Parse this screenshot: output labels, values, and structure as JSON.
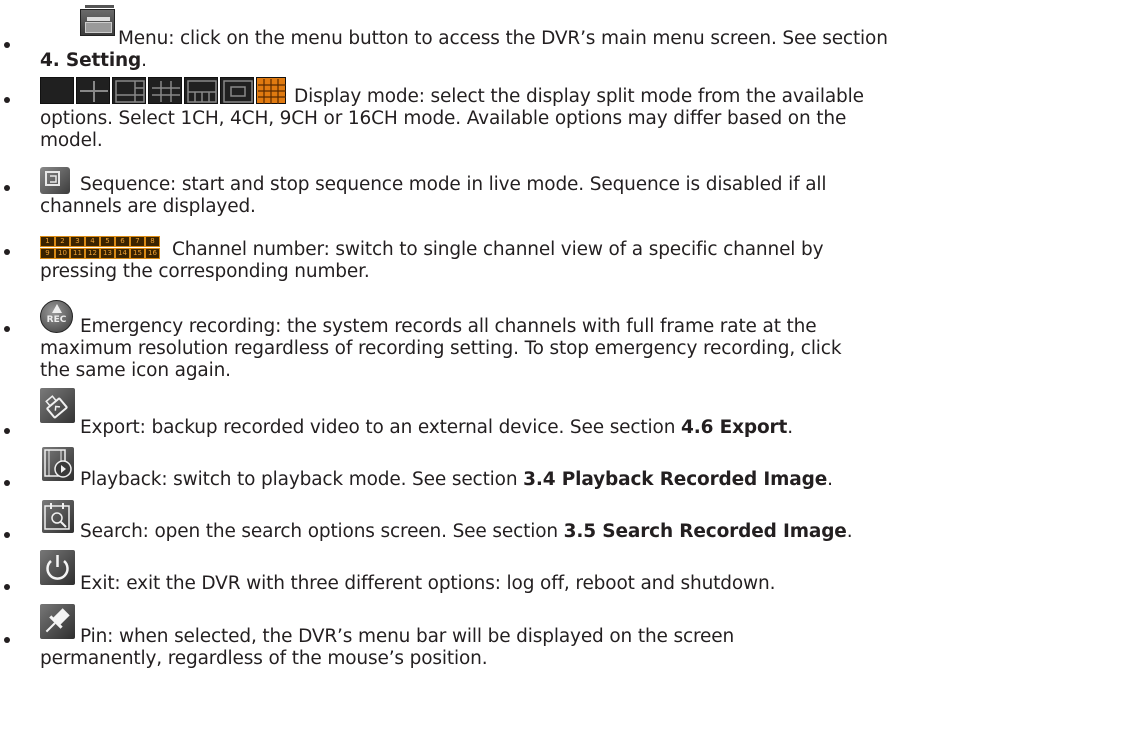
{
  "items": [
    {
      "name": "menu",
      "icon": "menu-monitor-icon",
      "lines": [
        {
          "text": "Menu: click on the menu button to access the DVR’s main menu screen. See section",
          "ref": ""
        },
        {
          "text": "",
          "ref": "4. Setting",
          "after": "."
        }
      ]
    },
    {
      "name": "display-mode",
      "icon": "display-split-icons",
      "lines": [
        {
          "text": "Display mode: select the display split mode from the available",
          "ref": ""
        },
        {
          "text": "options. Select 1CH, 4CH, 9CH or 16CH mode. Available options may differ based on the",
          "ref": ""
        },
        {
          "text": "model.",
          "ref": ""
        }
      ]
    },
    {
      "name": "sequence",
      "icon": "sequence-icon",
      "lines": [
        {
          "text": "Sequence: start and stop sequence mode in live mode. Sequence is disabled if all",
          "ref": ""
        },
        {
          "text": "channels are displayed.",
          "ref": ""
        }
      ]
    },
    {
      "name": "channel-number",
      "icon": "channel-number-icons",
      "channels": [
        "1",
        "2",
        "3",
        "4",
        "5",
        "6",
        "7",
        "8",
        "9",
        "10",
        "11",
        "12",
        "13",
        "14",
        "15",
        "16"
      ],
      "lines": [
        {
          "text": "Channel number: switch to single channel view of a specific channel by",
          "ref": ""
        },
        {
          "text": "pressing the corresponding number.",
          "ref": ""
        }
      ]
    },
    {
      "name": "emergency-recording",
      "icon": "rec-warning-icon",
      "icon_label": "REC",
      "lines": [
        {
          "text": "Emergency recording: the system records all channels with full frame rate at the",
          "ref": ""
        },
        {
          "text": "maximum resolution regardless of recording setting. To stop emergency recording, click",
          "ref": ""
        },
        {
          "text": "the same icon again.",
          "ref": ""
        }
      ]
    },
    {
      "name": "export",
      "icon": "usb-export-icon",
      "lines": [
        {
          "text": "Export: backup recorded video to an external device. See section ",
          "ref": "4.6 Export",
          "after": "."
        }
      ]
    },
    {
      "name": "playback",
      "icon": "film-play-icon",
      "lines": [
        {
          "text": "Playback: switch to playback mode. See section ",
          "ref": "3.4 Playback Recorded Image",
          "after": "."
        }
      ]
    },
    {
      "name": "search",
      "icon": "calendar-search-icon",
      "lines": [
        {
          "text": "Search: open the search options screen. See section ",
          "ref": "3.5 Search Recorded Image",
          "after": "."
        }
      ]
    },
    {
      "name": "exit",
      "icon": "power-icon",
      "lines": [
        {
          "text": "Exit: exit the DVR with three different options: log off, reboot and shutdown.",
          "ref": ""
        }
      ]
    },
    {
      "name": "pin",
      "icon": "pushpin-icon",
      "lines": [
        {
          "text": "Pin: when selected, the DVR’s menu bar will be displayed on the screen",
          "ref": ""
        },
        {
          "text": "permanently, regardless of the mouse’s position.",
          "ref": ""
        }
      ]
    }
  ],
  "colors": {
    "text": "#231f20",
    "accent_orange": "#e07a10",
    "icon_gray": "#4a4a4a"
  }
}
